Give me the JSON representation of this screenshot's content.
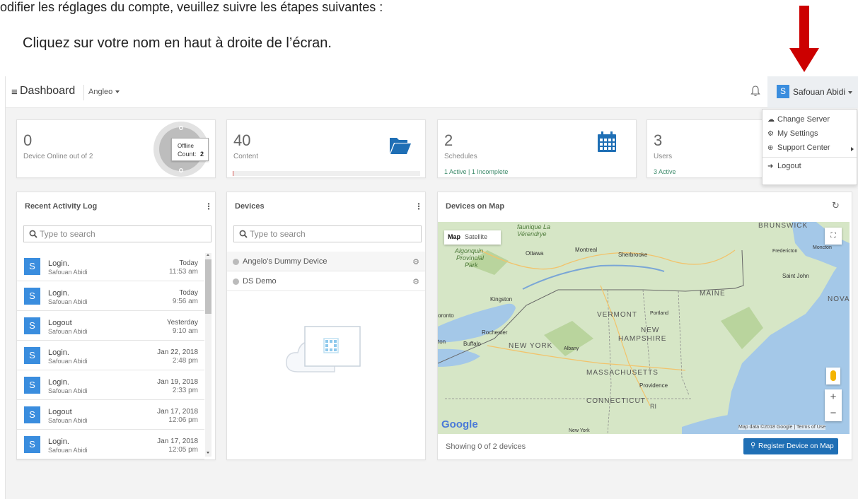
{
  "instructions": {
    "line1": "odifier les réglages du compte, veuillez suivre les étapes suivantes :",
    "line2": "Cliquez sur votre nom en haut à droite de l’écran."
  },
  "topbar": {
    "menu_icon": "hamburger-icon",
    "title": "Dashboard",
    "account": "Angleo",
    "bell_icon": "bell-icon",
    "user_initial": "S",
    "user_name": "Safouan Abidi"
  },
  "user_dropdown": [
    {
      "icon": "cloud-icon",
      "label": "Change Server"
    },
    {
      "icon": "gear-icon",
      "label": "My Settings"
    },
    {
      "icon": "lifebuoy-icon",
      "label": "Support Center"
    },
    {
      "icon": "logout-icon",
      "label": "Logout"
    }
  ],
  "stats": {
    "devices": {
      "number": "0",
      "label": "Device Online out of 2",
      "tooltip_line1": "Offline",
      "tooltip_count_label": "Count:",
      "tooltip_count": "2"
    },
    "content": {
      "number": "40",
      "label": "Content",
      "icon": "folder-open-icon"
    },
    "schedules": {
      "number": "2",
      "label": "Schedules",
      "footer": "1 Active | 1 Incomplete",
      "icon": "calendar-icon"
    },
    "users": {
      "number": "3",
      "label": "Users",
      "footer": "3 Active"
    }
  },
  "activity": {
    "title": "Recent Activity Log",
    "search_placeholder": "Type to search",
    "rows": [
      {
        "initial": "S",
        "action": "Login.",
        "user": "Safouan Abidi",
        "date": "Today",
        "time": "11:53 am"
      },
      {
        "initial": "S",
        "action": "Login.",
        "user": "Safouan Abidi",
        "date": "Today",
        "time": "9:56 am"
      },
      {
        "initial": "S",
        "action": "Logout",
        "user": "Safouan Abidi",
        "date": "Yesterday",
        "time": "9:10 am"
      },
      {
        "initial": "S",
        "action": "Login.",
        "user": "Safouan Abidi",
        "date": "Jan 22, 2018",
        "time": "2:48 pm"
      },
      {
        "initial": "S",
        "action": "Login.",
        "user": "Safouan Abidi",
        "date": "Jan 19, 2018",
        "time": "2:33 pm"
      },
      {
        "initial": "S",
        "action": "Logout",
        "user": "Safouan Abidi",
        "date": "Jan 17, 2018",
        "time": "12:06 pm"
      },
      {
        "initial": "S",
        "action": "Login.",
        "user": "Safouan Abidi",
        "date": "Jan 17, 2018",
        "time": "12:05 pm"
      }
    ]
  },
  "devices": {
    "title": "Devices",
    "search_placeholder": "Type to search",
    "items": [
      "Angelo's Dummy Device",
      "DS Demo"
    ]
  },
  "map": {
    "title": "Devices on Map",
    "tab_map": "Map",
    "tab_satellite": "Satellite",
    "labels": {
      "ottawa": "Ottawa",
      "montreal": "Montreal",
      "sherbrooke": "Sherbrooke",
      "kingston": "Kingston",
      "toronto": "oronto",
      "rochester": "Rochester",
      "buffalo": "Buffalo",
      "albany": "Albany",
      "portland": "Portland",
      "providence": "Providence",
      "fredericton": "Fredericton",
      "moncton": "Moncton",
      "saint_john": "Saint John",
      "maine": "MAINE",
      "vermont": "VERMONT",
      "new": "NEW",
      "hampshire": "HAMPSHIRE",
      "new_york": "NEW YORK",
      "massachusetts": "MASSACHUSETTS",
      "connecticut": "CONNECTICUT",
      "ri": "RI",
      "brunswick": "BRUNSWICK",
      "nova": "NOVA",
      "algonquin": "Algonquin",
      "provincial": "Provincial",
      "park": "Park",
      "faunique": "faunique La",
      "verendrye": "Vérendrye",
      "new_york_city": "New York",
      "ton": "ton"
    },
    "google": "Google",
    "attribution": "Map data ©2018 Google | Terms of Use",
    "zoom_in": "+",
    "zoom_out": "−",
    "footer": "Showing 0 of 2 devices",
    "register_button": "Register Device on Map"
  },
  "colors": {
    "accent": "#3a8dde",
    "register": "#1f6fb5",
    "arrow": "#cc0000",
    "water": "#a4c8e8",
    "land": "#d6e6c6"
  }
}
